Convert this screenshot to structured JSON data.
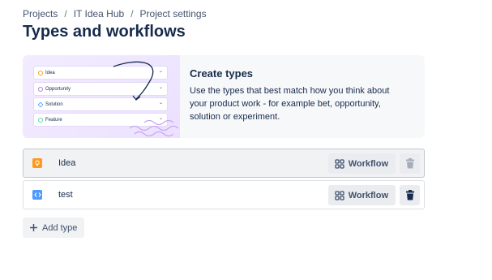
{
  "breadcrumb": {
    "items": [
      "Projects",
      "IT Idea Hub",
      "Project settings"
    ],
    "separator": "/"
  },
  "page_title": "Types and workflows",
  "banner": {
    "title": "Create types",
    "description": "Use the types that best match how you think about your product work - for example bet, opportunity, solution or experiment.",
    "illustration_items": [
      {
        "label": "Idea",
        "color": "#f79a32"
      },
      {
        "label": "Opportunity",
        "color": "#b27ee4"
      },
      {
        "label": "Solution",
        "color": "#4c9aff"
      },
      {
        "label": "Feature",
        "color": "#57d9a3"
      }
    ]
  },
  "types": [
    {
      "name": "Idea",
      "icon": "lightbulb-icon",
      "color": "#ff991f",
      "selected": true,
      "workflow_label": "Workflow",
      "delete_enabled": false
    },
    {
      "name": "test",
      "icon": "code-icon",
      "color": "#4c9aff",
      "selected": false,
      "workflow_label": "Workflow",
      "delete_enabled": true
    }
  ],
  "add_type_label": "Add type"
}
